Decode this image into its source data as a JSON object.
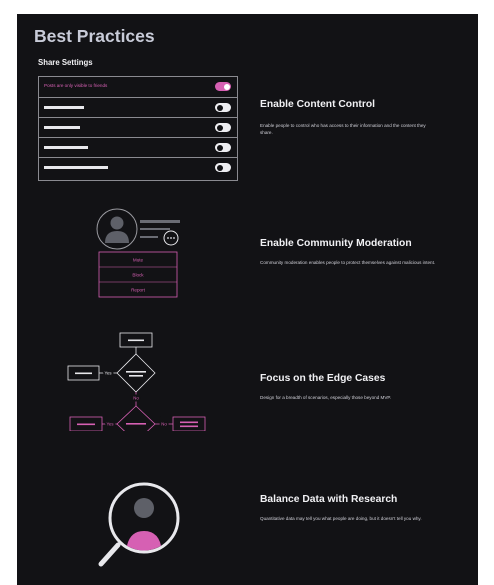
{
  "page_title": "Best Practices",
  "share_settings": {
    "heading": "Share Settings",
    "rows": [
      {
        "label": "Posts are only visible to friends",
        "bar_width": 0,
        "state": "on"
      },
      {
        "label": "",
        "bar_width": 40,
        "state": "off"
      },
      {
        "label": "",
        "bar_width": 36,
        "state": "off"
      },
      {
        "label": "",
        "bar_width": 44,
        "state": "off"
      },
      {
        "label": "",
        "bar_width": 64,
        "state": "off"
      }
    ]
  },
  "sections": [
    {
      "title": "Enable Content Control",
      "body": "Enable people to control who has access to their information and the content they share."
    },
    {
      "title": "Enable Community Moderation",
      "body": "Community moderation enables people to protect themselves against malicious intent."
    },
    {
      "title": "Focus on the Edge Cases",
      "body": "Design for a breadth of scenarios, especially those beyond MVP."
    },
    {
      "title": "Balance Data with Research",
      "body": "Quantitative data may tell you what people are doing, but it doesn't tell you why."
    }
  ],
  "moderation_menu": [
    "Mute",
    "Block",
    "Report"
  ],
  "flow_labels": {
    "yes": "Yes",
    "no": "No"
  },
  "colors": {
    "background": "#121215",
    "accent": "#d660b3",
    "line": "#e8e8ec",
    "avatar": "#5e6068"
  }
}
